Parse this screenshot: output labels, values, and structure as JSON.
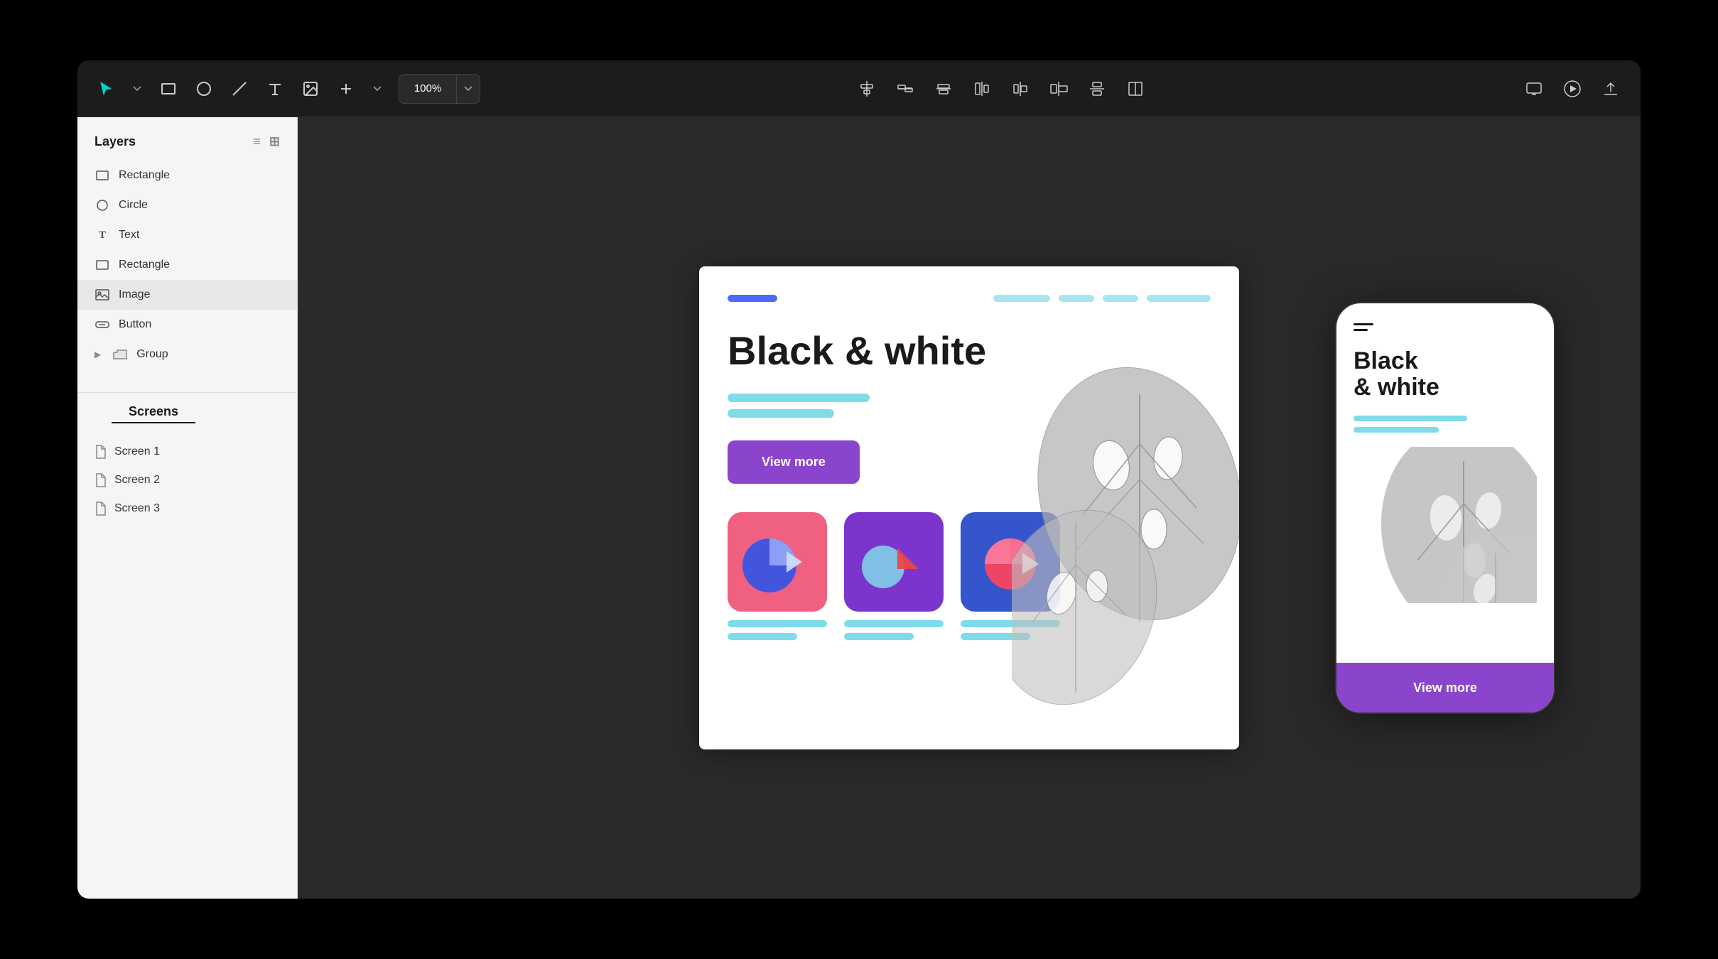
{
  "toolbar": {
    "zoom_value": "100%",
    "zoom_dropdown": "▾",
    "tools": [
      "cursor",
      "rectangle",
      "circle",
      "line",
      "text",
      "image",
      "add"
    ]
  },
  "sidebar": {
    "layers_title": "Layers",
    "layers": [
      {
        "id": 1,
        "label": "Rectangle",
        "type": "rect"
      },
      {
        "id": 2,
        "label": "Circle",
        "type": "circle"
      },
      {
        "id": 3,
        "label": "Text",
        "type": "text"
      },
      {
        "id": 4,
        "label": "Rectangle",
        "type": "rect"
      },
      {
        "id": 5,
        "label": "Image",
        "type": "image",
        "active": true
      },
      {
        "id": 6,
        "label": "Button",
        "type": "button"
      },
      {
        "id": 7,
        "label": "Group",
        "type": "folder",
        "expandable": true
      }
    ],
    "screens_title": "Screens",
    "screens": [
      {
        "id": 1,
        "label": "Screen 1"
      },
      {
        "id": 2,
        "label": "Screen 2"
      },
      {
        "id": 3,
        "label": "Screen 3"
      }
    ]
  },
  "canvas": {
    "heading": "Black & white",
    "button_label": "View more",
    "nav_bar_items": [
      "",
      "",
      "",
      ""
    ],
    "text_line1_width": "200px",
    "text_line2_width": "140px"
  },
  "mobile": {
    "heading_line1": "Black",
    "heading_line2": "& white",
    "footer_button": "View more"
  }
}
